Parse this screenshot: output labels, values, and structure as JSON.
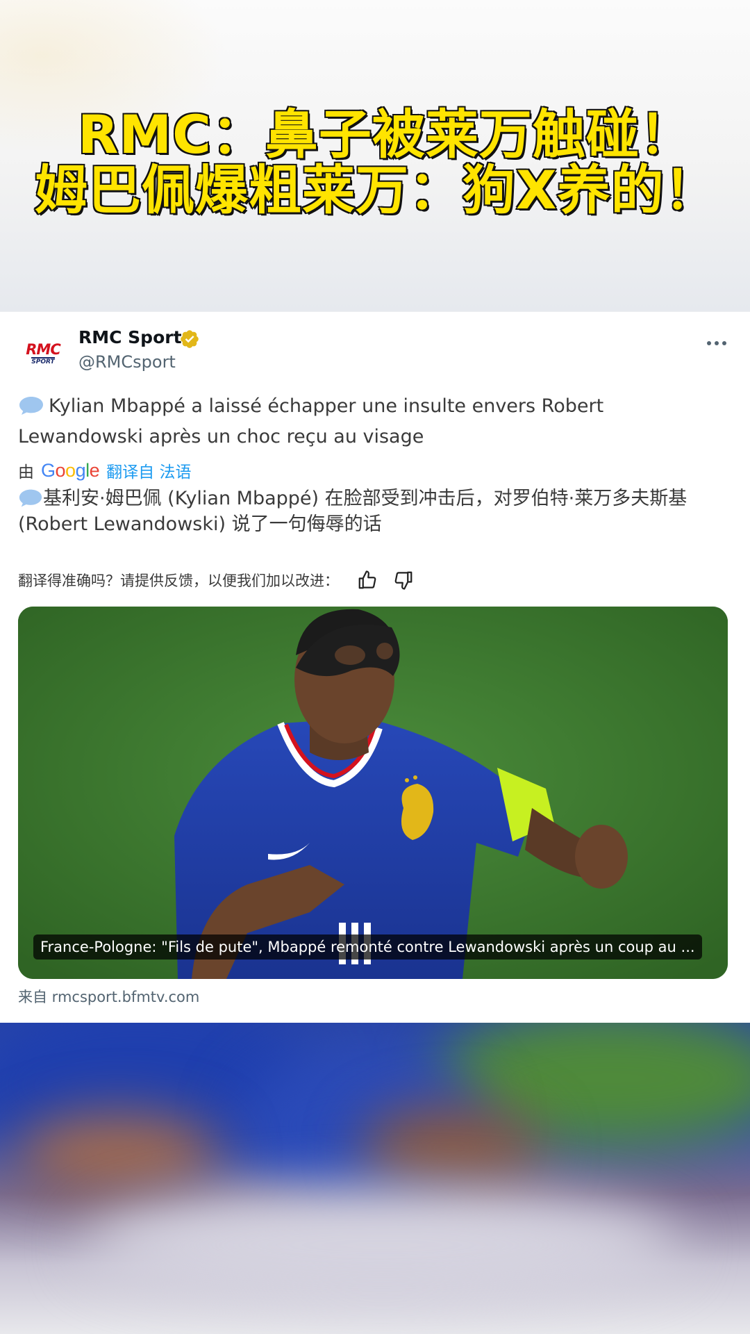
{
  "headline": {
    "line1": "RMC：鼻子被莱万触碰！",
    "line2": "姆巴佩爆粗莱万：狗X养的！"
  },
  "tweet": {
    "avatar_text_top": "RMC",
    "avatar_text_bottom": "SPORT",
    "display_name": "RMC Sport",
    "handle": "@RMCsport",
    "original_text": "Kylian Mbappé a laissé échapper une insulte envers Robert Lewandowski après un choc reçu au visage",
    "translate_by": "由",
    "google_logo": "Google",
    "translate_link": "翻译自 法语",
    "translated_text": "基利安·姆巴佩 (Kylian Mbappé) 在脸部受到冲击后，对罗伯特·莱万多夫斯基 (Robert Lewandowski) 说了一句侮辱的话",
    "feedback_prompt": "翻译得准确吗？请提供反馈，以便我们加以改进：",
    "media_caption": "France-Pologne: \"Fils de pute\", Mbappé remonté contre Lewandowski après un coup au ...",
    "link_source": "来自 rmcsport.bfmtv.com"
  },
  "icons": [
    "verified-badge-icon",
    "more-icon",
    "speech-bubble-icon",
    "thumbs-up-icon",
    "thumbs-down-icon"
  ],
  "colors": {
    "headline_fill": "#ffe400",
    "headline_stroke": "#111111",
    "link_blue": "#1d9bf0",
    "verified_gold": "#e2b719",
    "secondary_text": "#536471",
    "jersey_blue": "#1f3fa8",
    "pitch_green": "#3f7c33"
  }
}
